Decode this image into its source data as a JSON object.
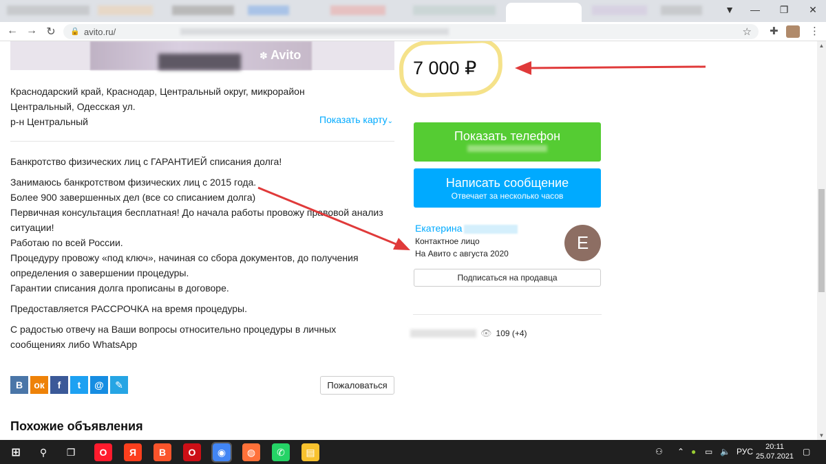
{
  "browser": {
    "url_prefix": "avito.ru/",
    "window_controls": {
      "minimize": "—",
      "restore": "❐",
      "close": "✕"
    },
    "nav": {
      "back": "←",
      "forward": "→",
      "reload": "↻"
    }
  },
  "listing": {
    "photo_watermark": "Avito",
    "address_line1": "Краснодарский край, Краснодар, Центральный округ, микрорайон",
    "address_line2": "Центральный, Одесская ул.",
    "district": "р-н Центральный",
    "show_map": "Показать карту",
    "description": [
      "Банкротство физических лиц с ГАРАНТИЕЙ списания долга!",
      "Занимаюсь банкротством физических лиц с 2015 года.\nБолее 900 завершенных дел (все со списанием долга)\nПервичная консультация бесплатная! До начала работы провожу правовой анализ ситуации!\nРаботаю по всей России.\nПроцедуру провожу «под ключ», начиная со сбора документов, до получения определения о завершении процедуры.\nГарантии списания долга прописаны в договоре.",
      "Предоставляется РАССРОЧКА на время процедуры.",
      "С радостью отвечу на Ваши вопросы относительно процедуры в личных сообщениях либо WhatsApp"
    ],
    "social": [
      {
        "label": "В",
        "color": "#4a76a8",
        "icon": "vk-icon"
      },
      {
        "label": "ок",
        "color": "#ee8208",
        "icon": "odnoklassniki-icon"
      },
      {
        "label": "f",
        "color": "#3b5998",
        "icon": "facebook-icon"
      },
      {
        "label": "t",
        "color": "#1da1f2",
        "icon": "twitter-icon"
      },
      {
        "label": "@",
        "color": "#168de2",
        "icon": "mailru-icon"
      },
      {
        "label": "✎",
        "color": "#26a5e4",
        "icon": "livejournal-icon"
      }
    ],
    "complain": "Пожаловаться",
    "similar_heading": "Похожие объявления"
  },
  "sidebar": {
    "price": "7 000 ₽",
    "show_phone": "Показать телефон",
    "write_message": "Написать сообщение",
    "write_message_sub": "Отвечает за несколько часов",
    "seller_name": "Екатерина",
    "seller_role": "Контактное лицо",
    "seller_since": "На Авито с августа 2020",
    "avatar_letter": "E",
    "subscribe": "Подписаться на продавца",
    "views": "109 (+4)"
  },
  "taskbar": {
    "language": "РУС",
    "time": "20:11",
    "date": "25.07.2021",
    "apps": [
      {
        "label": "O",
        "color": "#ff1b2d",
        "icon": "opera-icon"
      },
      {
        "label": "Я",
        "color": "#fc3f1d",
        "icon": "yandex-icon"
      },
      {
        "label": "B",
        "color": "#fb542b",
        "icon": "brave-icon"
      },
      {
        "label": "O",
        "color": "#cc0f16",
        "icon": "opera-gx-icon"
      },
      {
        "label": "◉",
        "color": "#4285f4",
        "icon": "chrome-icon"
      },
      {
        "label": "◍",
        "color": "#ff7139",
        "icon": "firefox-icon"
      },
      {
        "label": "✆",
        "color": "#25d366",
        "icon": "whatsapp-icon"
      },
      {
        "label": "▤",
        "color": "#f8c22e",
        "icon": "file-explorer-icon"
      }
    ]
  },
  "colors": {
    "accent_green": "#55cc33",
    "accent_blue": "#00aaff",
    "annotation_arrow": "#e03a3a",
    "highlight": "#f5e28a"
  }
}
